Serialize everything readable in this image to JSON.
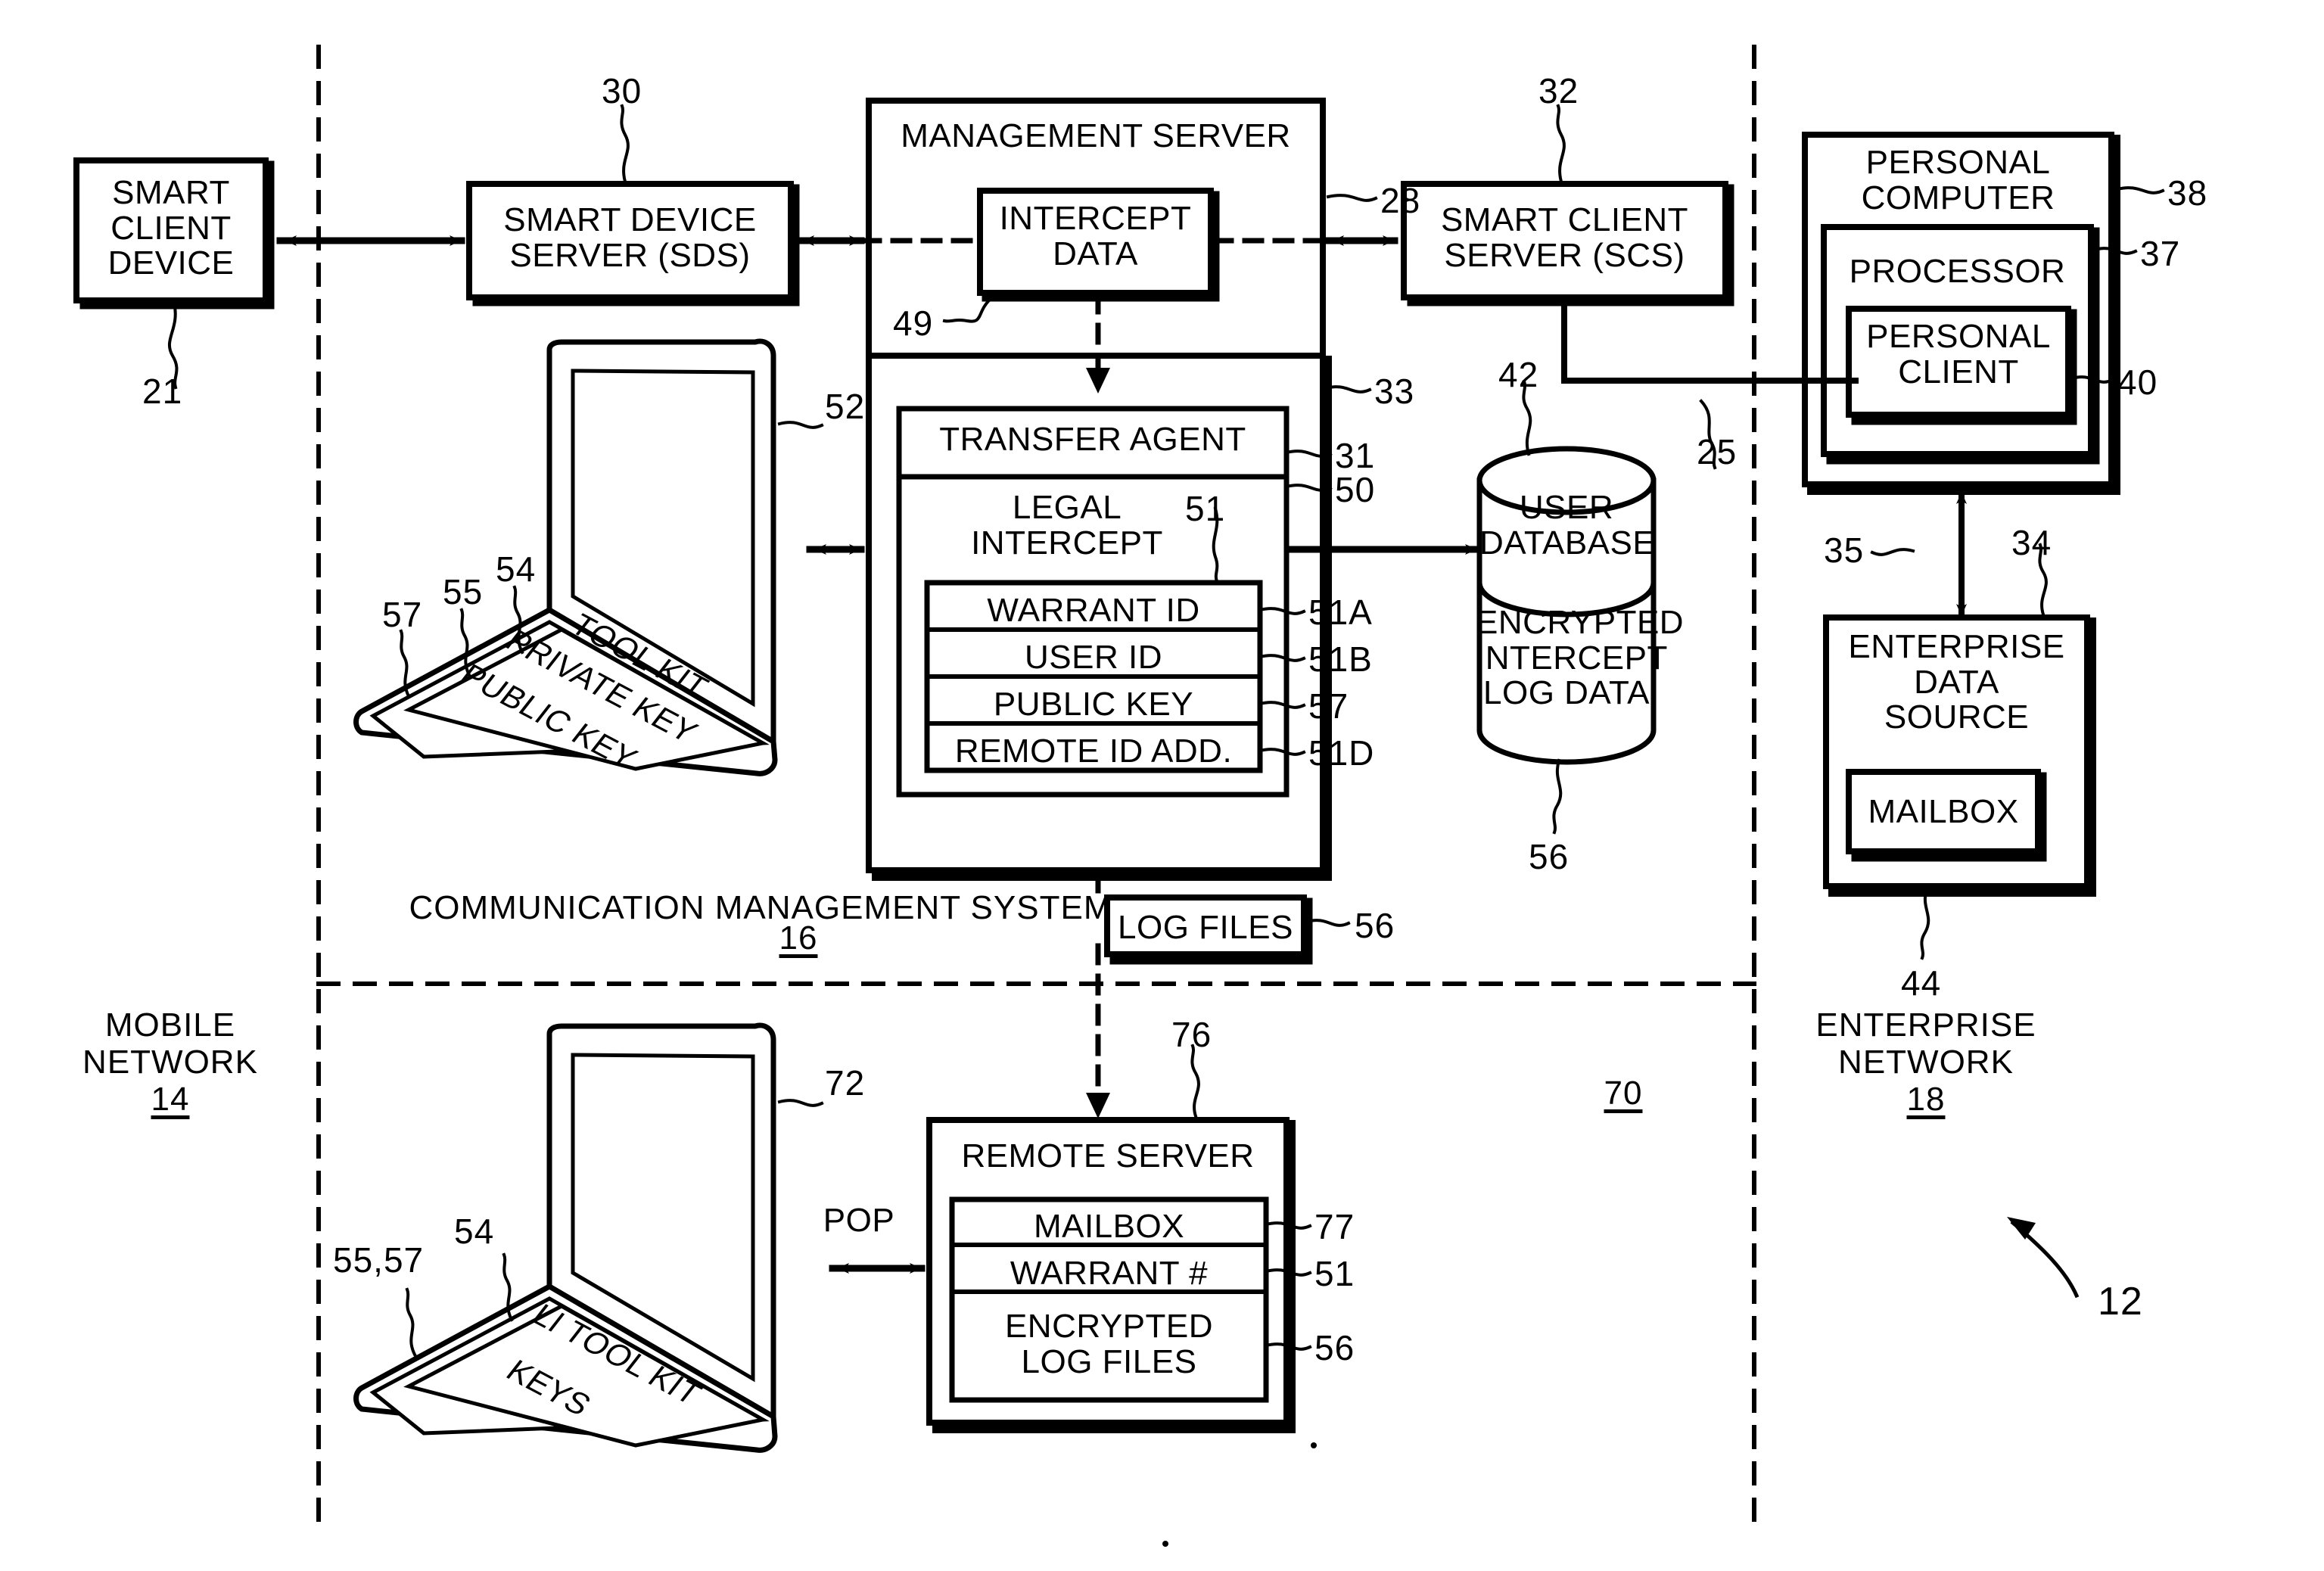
{
  "figure": {
    "id_ref": "12",
    "networks": [
      {
        "name": "mobile-network",
        "label": "MOBILE\nNETWORK",
        "ref": "14"
      },
      {
        "name": "communication-management-system",
        "label": "COMMUNICATION\nMANAGEMENT SYSTEM",
        "ref": "16"
      },
      {
        "name": "enterprise-network",
        "label": "ENTERPRISE\nNETWORK",
        "ref": "18"
      },
      {
        "name": "lower-region",
        "label": "",
        "ref": "70"
      }
    ]
  },
  "blocks": {
    "smart_client_device": {
      "label": "SMART\nCLIENT\nDEVICE",
      "ref": "21"
    },
    "smart_device_server": {
      "label": "SMART DEVICE\nSERVER (SDS)",
      "ref": "30"
    },
    "management_server": {
      "label": "MANAGEMENT SERVER",
      "ref": "28"
    },
    "intercept_data": {
      "label": "INTERCEPT\nDATA",
      "ref": "49"
    },
    "smart_client_server": {
      "label": "SMART CLIENT\nSERVER (SCS)",
      "ref": "32"
    },
    "personal_computer": {
      "label": "PERSONAL\nCOMPUTER",
      "ref": "38"
    },
    "processor": {
      "label": "PROCESSOR",
      "ref": "37"
    },
    "personal_client": {
      "label": "PERSONAL\nCLIENT",
      "ref": "40"
    },
    "transfer_agent": {
      "label": "TRANSFER AGENT",
      "ref": "31"
    },
    "legal_intercept": {
      "label": "LEGAL\nINTERCEPT",
      "ref": "50",
      "inner_ref": "51"
    },
    "legal_intercept_fields": [
      {
        "label": "WARRANT ID",
        "ref": "51A"
      },
      {
        "label": "USER ID",
        "ref": "51B"
      },
      {
        "label": "PUBLIC KEY",
        "ref": "57"
      },
      {
        "label": "REMOTE ID ADD.",
        "ref": "51D"
      }
    ],
    "cms_container": {
      "ref": "33"
    },
    "user_database": {
      "label": "USER\nDATABASE",
      "ref": "42"
    },
    "encrypted_intercept_log_data": {
      "label": "ENCRYPTED\nINTERCEPT\nLOG DATA",
      "ref": "56"
    },
    "log_files": {
      "label": "LOG FILES",
      "ref": "56"
    },
    "enterprise_data_source": {
      "label": "ENTERPRISE\nDATA\nSOURCE",
      "ref": "34"
    },
    "eds_mailbox": {
      "label": "MAILBOX",
      "ref": "44"
    },
    "eds_link": {
      "ref": "35"
    },
    "scs_pc_link": {
      "ref": "25"
    },
    "remote_server": {
      "label": "REMOTE SERVER",
      "ref": "76"
    },
    "remote_server_fields": [
      {
        "label": "MAILBOX",
        "ref": "77"
      },
      {
        "label": "WARRANT #",
        "ref": "51"
      },
      {
        "label": "ENCRYPTED\nLOG FILES",
        "ref": "56"
      }
    ],
    "laptop_top": {
      "ref": "52",
      "screen_ref": "52"
    },
    "laptop_top_keys": [
      {
        "label": "TOOL KIT",
        "ref": "54"
      },
      {
        "label": "PRIVATE KEY",
        "ref": "55"
      },
      {
        "label": "PUBLIC KEY",
        "ref": "57"
      }
    ],
    "laptop_bottom": {
      "ref": "72"
    },
    "laptop_bottom_keys": [
      {
        "label": "LI TOOL KIT",
        "ref": "54"
      },
      {
        "label": "KEYS",
        "ref": "55,57"
      }
    ],
    "pop_link": {
      "label": "POP"
    }
  },
  "colors": {
    "ink": "#000000",
    "paper": "#ffffff"
  }
}
